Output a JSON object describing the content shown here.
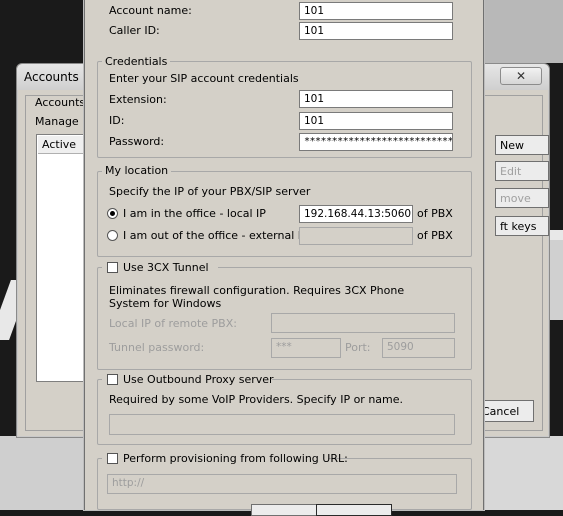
{
  "background_window": {
    "title": "Accounts",
    "close_glyph": "✕",
    "group_label": "Accounts",
    "manage_text": "Manage S",
    "list_header": "Active",
    "buttons": [
      {
        "label": "New",
        "enabled": true
      },
      {
        "label": "Edit",
        "enabled": false
      },
      {
        "label": "move",
        "enabled": false
      },
      {
        "label": "ft keys",
        "enabled": true
      }
    ],
    "cancel_label": "Cancel"
  },
  "account": {
    "name_label": "Account name:",
    "name_value": "101",
    "caller_id_label": "Caller ID:",
    "caller_id_value": "101"
  },
  "credentials": {
    "title": "Credentials",
    "intro": "Enter your SIP account credentials",
    "extension_label": "Extension:",
    "extension_value": "101",
    "id_label": "ID:",
    "id_value": "101",
    "password_label": "Password:",
    "password_value": "****************************"
  },
  "location": {
    "title": "My location",
    "intro": "Specify the IP of your PBX/SIP server",
    "local_label": "I am in the office - local IP",
    "local_value": "192.168.44.13:5060",
    "local_selected": true,
    "external_label": "I am out of the office - external IP",
    "external_value": "",
    "of_pbx_label": "of PBX"
  },
  "tunnel": {
    "checkbox_label": "Use 3CX Tunnel",
    "checked": false,
    "description": "Eliminates firewall configuration. Requires 3CX Phone System for Windows",
    "local_ip_label": "Local IP of remote PBX:",
    "local_ip_value": "",
    "password_label": "Tunnel password:",
    "password_value": "***",
    "port_label": "Port:",
    "port_value": "5090"
  },
  "proxy": {
    "checkbox_label": "Use Outbound Proxy server",
    "checked": false,
    "description": "Required by some VoIP Providers. Specify IP or name.",
    "value": ""
  },
  "provisioning": {
    "checkbox_label": "Perform provisioning from following URL:",
    "checked": false,
    "url_value": "http://"
  },
  "colors": {
    "dialog_face": "#d4d0c8",
    "disabled_text": "#9d9d9d",
    "desktop": "#1a1a1a"
  }
}
